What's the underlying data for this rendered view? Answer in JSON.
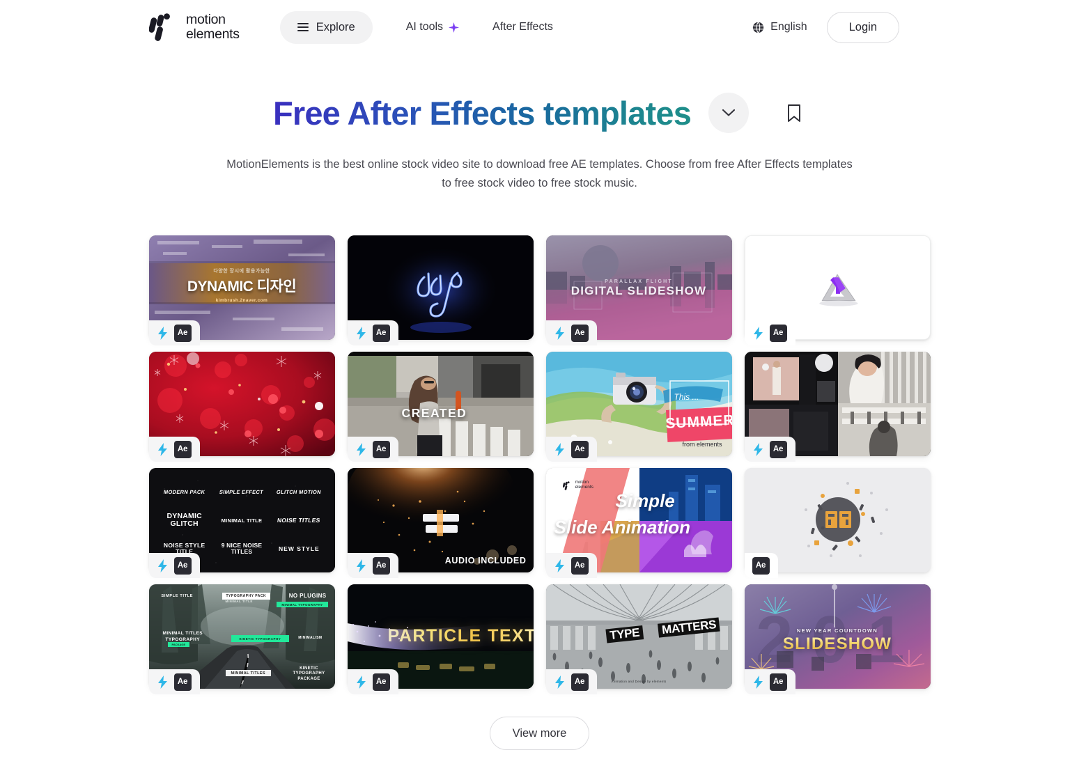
{
  "header": {
    "logo": {
      "name": "motionelements-logo",
      "line1": "motion",
      "line2": "elements"
    },
    "explore_label": "Explore",
    "nav": [
      {
        "label": "AI tools",
        "icon": "sparkle-icon"
      },
      {
        "label": "After Effects",
        "icon": null
      }
    ],
    "language_label": "English",
    "language_icon": "globe-icon",
    "login_label": "Login"
  },
  "hero": {
    "title": "Free After Effects templates",
    "title_gradient_from": "#3a2fbf",
    "title_gradient_to": "#1f8f8a",
    "expand_icon": "chevron-down-icon",
    "bookmark_icon": "bookmark-icon",
    "subtitle": "MotionElements is the best online stock video site to download free AE templates. Choose from free After Effects templates to free stock video to free stock music."
  },
  "grid": {
    "cards": [
      {
        "id": 1,
        "title": "DYNAMIC 디자인",
        "subtitle": "다양한 장시에 활용가능한",
        "caption": "kimbrush.2naver.com",
        "style": "dynamic-korean",
        "badges": [
          "free-bolt",
          "Ae"
        ]
      },
      {
        "id": 2,
        "title": "",
        "subtitle": "",
        "caption": "",
        "style": "neon-logo",
        "badges": [
          "free-bolt",
          "Ae"
        ]
      },
      {
        "id": 3,
        "title": "DIGITAL SLIDESHOW",
        "subtitle": "PARALLAX FLIGHT",
        "caption": "",
        "style": "digital-slideshow",
        "badges": [
          "free-bolt",
          "Ae"
        ]
      },
      {
        "id": 4,
        "title": "",
        "subtitle": "",
        "caption": "",
        "style": "white-3d-logo",
        "badges": [
          "free-bolt",
          "Ae"
        ]
      },
      {
        "id": 5,
        "title": "",
        "subtitle": "",
        "caption": "",
        "style": "red-bokeh",
        "badges": [
          "free-bolt",
          "Ae"
        ]
      },
      {
        "id": 6,
        "title": "CREATED",
        "subtitle": "",
        "caption": "",
        "style": "created-street",
        "badges": [
          "free-bolt",
          "Ae"
        ]
      },
      {
        "id": 7,
        "title": "SUMMER",
        "subtitle": "This ...",
        "caption": "from elements",
        "style": "summer-camera",
        "badges": [
          "free-bolt",
          "Ae"
        ]
      },
      {
        "id": 8,
        "title": "",
        "subtitle": "",
        "caption": "",
        "style": "fashion-collage",
        "badges": [
          "free-bolt",
          "Ae"
        ]
      },
      {
        "id": 9,
        "title": "",
        "subtitle": "",
        "caption": "",
        "style": "titles-pack-grid",
        "badges": [
          "free-bolt",
          "Ae"
        ],
        "tiles": [
          "MODERN PACK",
          "SIMPLE EFFECT",
          "GLITCH MOTION",
          "DYNAMIC GLITCH",
          "MINIMAL TITLE",
          "NOISE TITLES",
          "NOISE STYLE TITLE",
          "9 NICE NOISE TITLES",
          "NEW STYLE"
        ]
      },
      {
        "id": 10,
        "title": "",
        "subtitle": "",
        "caption": "AUDIO INCLUDED",
        "style": "particles-logo",
        "badges": [
          "free-bolt",
          "Ae"
        ]
      },
      {
        "id": 11,
        "title": "Simple",
        "subtitle": "Slide Animation",
        "caption": "",
        "style": "simple-slide",
        "badges": [
          "free-bolt",
          "Ae"
        ]
      },
      {
        "id": 12,
        "title": "",
        "subtitle": "",
        "caption": "",
        "style": "gray-burst-logo",
        "badges": [
          "Ae"
        ]
      },
      {
        "id": 13,
        "title": "NO PLUGINS",
        "subtitle": "MINIMAL TITLES TYPOGRAPHY",
        "caption": "KINETIC TYPOGRAPHY PACKAGE",
        "style": "forest-road-titles",
        "badges": [
          "free-bolt",
          "Ae"
        ]
      },
      {
        "id": 14,
        "title": "PARTICLE TEXT",
        "subtitle": "",
        "caption": "",
        "style": "particle-text",
        "badges": [
          "free-bolt",
          "Ae"
        ]
      },
      {
        "id": 15,
        "title": "TYPE MATTERS",
        "subtitle": "",
        "caption": "Animation and Design by elements",
        "style": "type-matters",
        "badges": [
          "free-bolt",
          "Ae"
        ]
      },
      {
        "id": 16,
        "title": "SLIDESHOW",
        "subtitle": "NEW YEAR COUNTDOWN",
        "caption": "",
        "style": "newyear-slideshow",
        "badges": [
          "free-bolt",
          "Ae"
        ]
      }
    ]
  },
  "footer": {
    "view_more_label": "View more"
  }
}
